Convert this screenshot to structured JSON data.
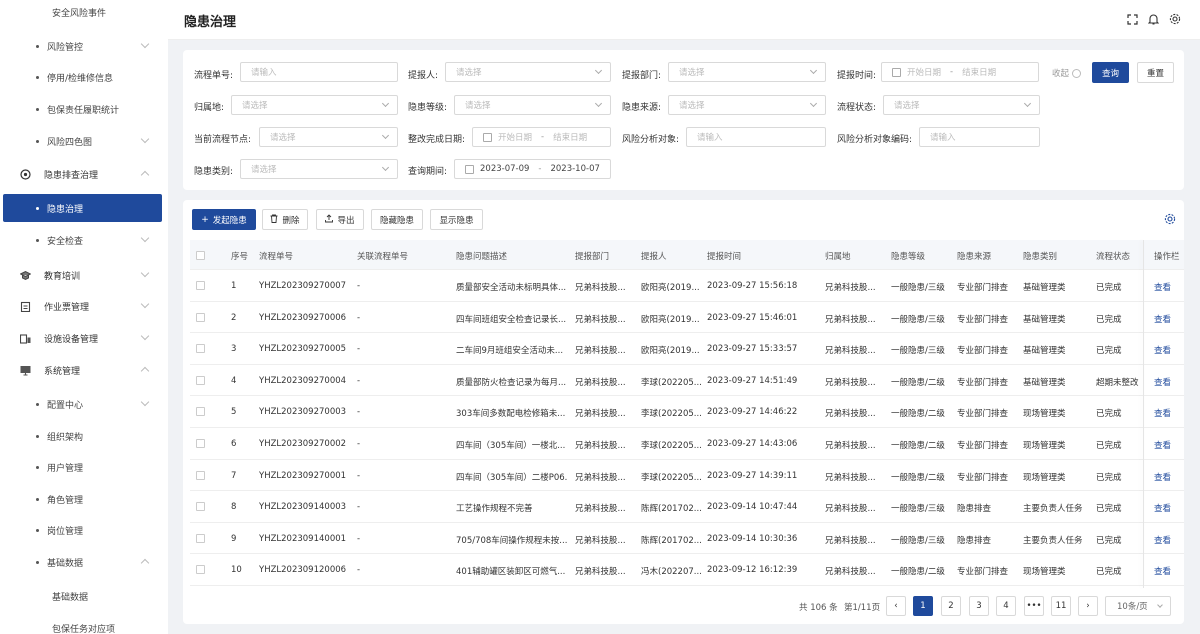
{
  "sidebar": {
    "items": [
      {
        "label": "安全风险事件",
        "level": 3
      },
      {
        "label": "风险管控",
        "level": 2,
        "chevron": "down"
      },
      {
        "label": "停用/检维修信息",
        "level": 2
      },
      {
        "label": "包保责任履职统计",
        "level": 2
      },
      {
        "label": "风险四色图",
        "level": 2,
        "chevron": "down"
      },
      {
        "label": "隐患排查治理",
        "level": 1,
        "chevron": "up",
        "icon": "target-icon"
      },
      {
        "label": "隐患治理",
        "level": 2,
        "active": true
      },
      {
        "label": "安全检查",
        "level": 2,
        "chevron": "down"
      },
      {
        "label": "教育培训",
        "level": 1,
        "chevron": "down",
        "icon": "graduation-icon"
      },
      {
        "label": "作业票管理",
        "level": 1,
        "chevron": "down",
        "icon": "clipboard-icon"
      },
      {
        "label": "设施设备管理",
        "level": 1,
        "chevron": "down",
        "icon": "device-icon"
      },
      {
        "label": "系统管理",
        "level": 1,
        "chevron": "up",
        "icon": "monitor-icon"
      },
      {
        "label": "配置中心",
        "level": 2,
        "chevron": "down"
      },
      {
        "label": "组织架构",
        "level": 2
      },
      {
        "label": "用户管理",
        "level": 2
      },
      {
        "label": "角色管理",
        "level": 2
      },
      {
        "label": "岗位管理",
        "level": 2
      },
      {
        "label": "基础数据",
        "level": 2,
        "chevron": "up"
      },
      {
        "label": "基础数据",
        "level": 3
      },
      {
        "label": "包保任务对应项",
        "level": 3
      }
    ]
  },
  "header": {
    "title": "隐患治理"
  },
  "filters": {
    "process_no": {
      "label": "流程单号:",
      "placeholder": "请输入"
    },
    "reporter": {
      "label": "提报人:",
      "placeholder": "请选择"
    },
    "dept": {
      "label": "提报部门:",
      "placeholder": "请选择"
    },
    "report_time": {
      "label": "提报时间:",
      "start": "开始日期",
      "end": "结束日期"
    },
    "location": {
      "label": "归属地:",
      "placeholder": "请选择"
    },
    "level": {
      "label": "隐患等级:",
      "placeholder": "请选择"
    },
    "source": {
      "label": "隐患来源:",
      "placeholder": "请选择"
    },
    "status": {
      "label": "流程状态:",
      "placeholder": "请选择"
    },
    "node": {
      "label": "当前流程节点:",
      "placeholder": "请选择"
    },
    "fix_date": {
      "label": "整改完成日期:",
      "start": "开始日期",
      "end": "结束日期"
    },
    "risk_obj": {
      "label": "风险分析对象:",
      "placeholder": "请输入"
    },
    "risk_code": {
      "label": "风险分析对象编码:",
      "placeholder": "请输入"
    },
    "category": {
      "label": "隐患类别:",
      "placeholder": "请选择"
    },
    "query_period": {
      "label": "查询期间:",
      "start": "2023-07-09",
      "end": "2023-10-07"
    },
    "collapse": "收起",
    "query": "查询",
    "reset": "重置"
  },
  "toolbar": {
    "create": "发起隐患",
    "delete": "删除",
    "export": "导出",
    "hide": "隐藏隐患",
    "show": "显示隐患"
  },
  "table": {
    "columns": [
      "序号",
      "流程单号",
      "关联流程单号",
      "隐患问题描述",
      "提报部门",
      "提报人",
      "提报时间",
      "归属地",
      "隐患等级",
      "隐患来源",
      "隐患类别",
      "流程状态",
      "操作栏"
    ],
    "rows": [
      [
        "1",
        "YHZL202309270007",
        "-",
        "质量部安全活动未标明具体...",
        "兄弟科技股...",
        "欧阳亮(2019...",
        "2023-09-27 15:56:18",
        "兄弟科技股...",
        "一般隐患/三级",
        "专业部门排查",
        "基础管理类",
        "已完成",
        "查看"
      ],
      [
        "2",
        "YHZL202309270006",
        "-",
        "四车间班组安全检查记录长...",
        "兄弟科技股...",
        "欧阳亮(2019...",
        "2023-09-27 15:46:01",
        "兄弟科技股...",
        "一般隐患/三级",
        "专业部门排查",
        "基础管理类",
        "已完成",
        "查看"
      ],
      [
        "3",
        "YHZL202309270005",
        "-",
        "二车间9月班组安全活动未...",
        "兄弟科技股...",
        "欧阳亮(2019...",
        "2023-09-27 15:33:57",
        "兄弟科技股...",
        "一般隐患/三级",
        "专业部门排查",
        "基础管理类",
        "已完成",
        "查看"
      ],
      [
        "4",
        "YHZL202309270004",
        "-",
        "质量部防火检查记录为每月...",
        "兄弟科技股...",
        "李球(202205...",
        "2023-09-27 14:51:49",
        "兄弟科技股...",
        "一般隐患/二级",
        "专业部门排查",
        "基础管理类",
        "超期未整改",
        "查看"
      ],
      [
        "5",
        "YHZL202309270003",
        "-",
        "303车间多数配电检修箱未...",
        "兄弟科技股...",
        "李球(202205...",
        "2023-09-27 14:46:22",
        "兄弟科技股...",
        "一般隐患/二级",
        "专业部门排查",
        "现场管理类",
        "已完成",
        "查看"
      ],
      [
        "6",
        "YHZL202309270002",
        "-",
        "四车间（305车间）一楼北...",
        "兄弟科技股...",
        "李球(202205...",
        "2023-09-27 14:43:06",
        "兄弟科技股...",
        "一般隐患/二级",
        "专业部门排查",
        "现场管理类",
        "已完成",
        "查看"
      ],
      [
        "7",
        "YHZL202309270001",
        "-",
        "四车间（305车间）二楼P06...",
        "兄弟科技股...",
        "李球(202205...",
        "2023-09-27 14:39:11",
        "兄弟科技股...",
        "一般隐患/二级",
        "专业部门排查",
        "现场管理类",
        "已完成",
        "查看"
      ],
      [
        "8",
        "YHZL202309140003",
        "-",
        "工艺操作规程不完善",
        "兄弟科技股...",
        "陈辉(201702...",
        "2023-09-14 10:47:44",
        "兄弟科技股...",
        "一般隐患/三级",
        "隐患排查",
        "主要负责人任务",
        "已完成",
        "查看"
      ],
      [
        "9",
        "YHZL202309140001",
        "-",
        "705/708车间操作规程未按...",
        "兄弟科技股...",
        "陈辉(201702...",
        "2023-09-14 10:30:36",
        "兄弟科技股...",
        "一般隐患/三级",
        "隐患排查",
        "主要负责人任务",
        "已完成",
        "查看"
      ],
      [
        "10",
        "YHZL202309120006",
        "-",
        "401辅助罐区装卸区可燃气...",
        "兄弟科技股...",
        "冯木(202207...",
        "2023-09-12 16:12:39",
        "兄弟科技股...",
        "一般隐患/二级",
        "专业部门排查",
        "现场管理类",
        "已完成",
        "查看"
      ]
    ]
  },
  "pagination": {
    "total": "共 106 条",
    "current": "第1/11页",
    "pages": [
      "1",
      "2",
      "3",
      "4",
      "•••",
      "11"
    ],
    "page_size": "10条/页"
  }
}
